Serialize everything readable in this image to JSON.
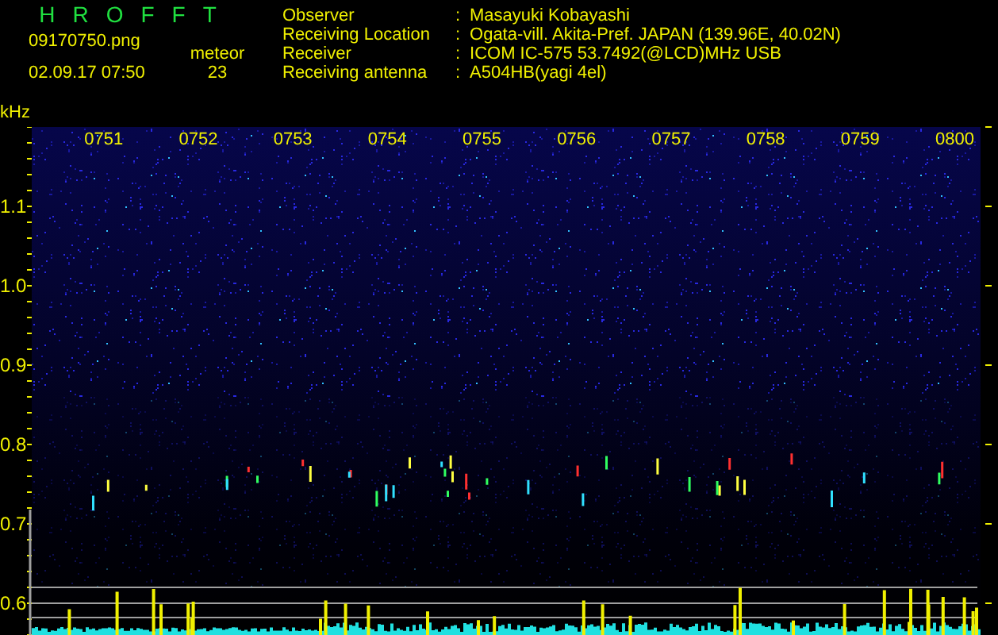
{
  "app_title": "HROFFT",
  "file_name": "09170750.png",
  "date_time": "02.09.17 07:50",
  "meteor_label": "meteor",
  "meteor_count": "23",
  "info": [
    {
      "label": "Observer",
      "value": "Masayuki Kobayashi"
    },
    {
      "label": "Receiving Location",
      "value": "Ogata-vill. Akita-Pref. JAPAN (139.96E, 40.02N)"
    },
    {
      "label": "Receiver",
      "value": "ICOM IC-575 53.7492(@LCD)MHz USB"
    },
    {
      "label": "Receiving antenna",
      "value": "A504HB(yagi 4el)"
    }
  ],
  "separator": ":",
  "freq_unit": "kHz",
  "time_labels": [
    "0751",
    "0752",
    "0753",
    "0754",
    "0755",
    "0756",
    "0757",
    "0758",
    "0759",
    "0800"
  ],
  "freq_labels": [
    "1.1",
    "1.0",
    "0.9",
    "0.8",
    "0.7",
    "0.6"
  ]
}
